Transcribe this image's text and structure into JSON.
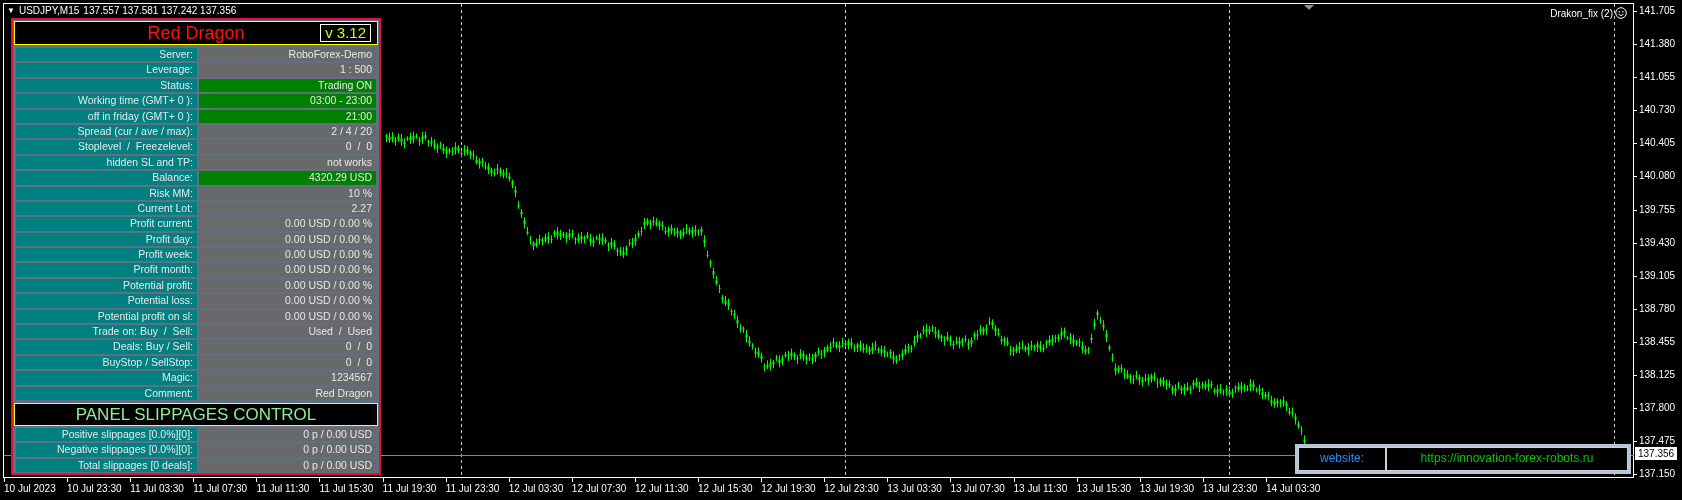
{
  "chart": {
    "menu_glyph": "▼",
    "title": "USDJPY,M15",
    "quotes": "137.557 137.581 137.242 137.356",
    "indicator": "Drakon_fix (2)"
  },
  "panel": {
    "title": "Red Dragon",
    "version": "v 3.12",
    "rows": [
      {
        "label": "Server:",
        "value": "RoboForex-Demo",
        "ok": false
      },
      {
        "label": "Leverage:",
        "value": "1 : 500",
        "ok": false
      },
      {
        "label": "Status:",
        "value": "Trading ON",
        "ok": true
      },
      {
        "label": "Working time (GMT+ 0 ):",
        "value": "03:00 - 23:00",
        "ok": true
      },
      {
        "label": "off in friday (GMT+ 0 ):",
        "value": "21:00",
        "ok": true
      },
      {
        "label": "Spread (cur / ave / max):",
        "value": "2 / 4 / 20",
        "ok": false
      },
      {
        "label": "Stoplevel  /  Freezelevel:",
        "value": "0  /  0",
        "ok": false
      },
      {
        "label": "hidden SL and TP:",
        "value": "not works",
        "ok": false
      },
      {
        "label": "Balance:",
        "value": "4320.29 USD",
        "ok": true
      },
      {
        "label": "Risk MM:",
        "value": "10 %",
        "ok": false
      },
      {
        "label": "Current Lot:",
        "value": "2.27",
        "ok": false
      },
      {
        "label": "Profit current:",
        "value": "0.00 USD / 0.00 %",
        "ok": false
      },
      {
        "label": "Profit day:",
        "value": "0.00 USD / 0.00 %",
        "ok": false
      },
      {
        "label": "Profit week:",
        "value": "0.00 USD / 0.00 %",
        "ok": false
      },
      {
        "label": "Profit month:",
        "value": "0.00 USD / 0.00 %",
        "ok": false
      },
      {
        "label": "Potential profit:",
        "value": "0.00 USD / 0.00 %",
        "ok": false
      },
      {
        "label": "Potential loss:",
        "value": "0.00 USD / 0.00 %",
        "ok": false
      },
      {
        "label": "Potential profit on sl:",
        "value": "0.00 USD / 0.00 %",
        "ok": false
      },
      {
        "label": "Trade on: Buy  /  Sell:",
        "value": "Used  /  Used",
        "ok": false
      },
      {
        "label": "Deals: Buy / Sell:",
        "value": "0  /  0",
        "ok": false
      },
      {
        "label": "BuyStop / SellStop:",
        "value": "0  /  0",
        "ok": false
      },
      {
        "label": "Magic:",
        "value": "1234567",
        "ok": false
      },
      {
        "label": "Comment:",
        "value": "Red Dragon",
        "ok": false
      }
    ],
    "slippage_title": "PANEL SLIPPAGES CONTROL",
    "slippage_rows": [
      {
        "label": "Positive slippages [0.0%][0]:",
        "value": "0 p / 0.00 USD",
        "ok": false
      },
      {
        "label": "Negative slippages [0.0%][0]:",
        "value": "0 p / 0.00 USD",
        "ok": false
      },
      {
        "label": "Total slippages [0 deals]:",
        "value": "0 p / 0.00 USD",
        "ok": false
      }
    ]
  },
  "website": {
    "label": "website:",
    "url": "https://innovation-forex-robots.ru"
  },
  "price_axis": {
    "ticks": [
      "141.705",
      "141.380",
      "141.055",
      "140.730",
      "140.405",
      "140.080",
      "139.755",
      "139.430",
      "139.105",
      "138.780",
      "138.455",
      "138.125",
      "137.800",
      "137.475",
      "137.150"
    ],
    "current": "137.356"
  },
  "time_axis": [
    "10 Jul 2023",
    "10 Jul 23:30",
    "11 Jul 03:30",
    "11 Jul 07:30",
    "11 Jul 11:30",
    "11 Jul 15:30",
    "11 Jul 19:30",
    "11 Jul 23:30",
    "12 Jul 03:30",
    "12 Jul 07:30",
    "12 Jul 11:30",
    "12 Jul 15:30",
    "12 Jul 19:30",
    "12 Jul 23:30",
    "13 Jul 03:30",
    "13 Jul 07:30",
    "13 Jul 11:30",
    "13 Jul 15:30",
    "13 Jul 19:30",
    "13 Jul 23:30",
    "14 Jul 03:30"
  ]
}
